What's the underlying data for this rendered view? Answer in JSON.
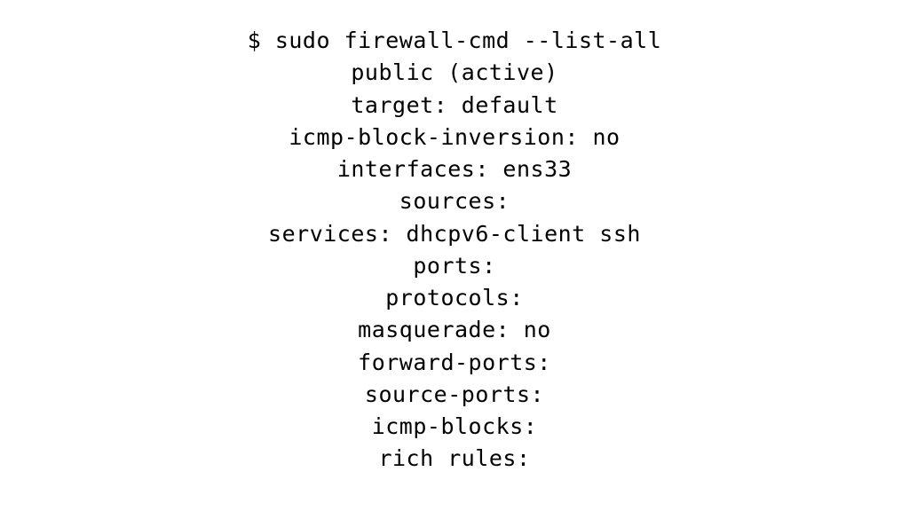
{
  "terminal": {
    "command": "$ sudo firewall-cmd --list-all",
    "lines": [
      "public (active)",
      "target: default",
      "icmp-block-inversion: no",
      "interfaces: ens33",
      "sources:",
      "services: dhcpv6-client ssh",
      "ports:",
      "protocols:",
      "masquerade: no",
      "forward-ports:",
      "source-ports:",
      "icmp-blocks:",
      "rich rules:"
    ]
  }
}
